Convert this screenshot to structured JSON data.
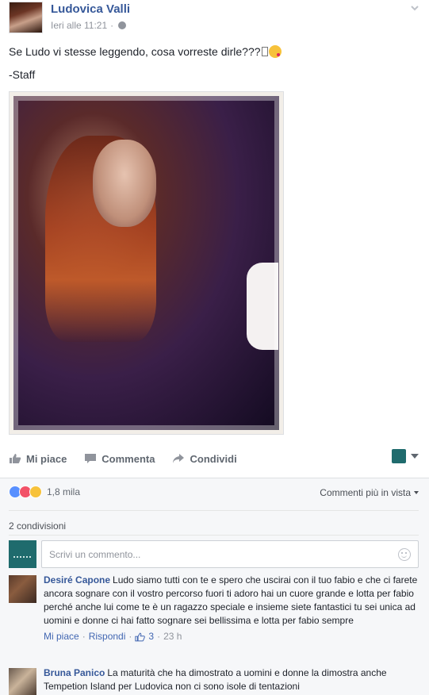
{
  "post": {
    "author": "Ludovica Valli",
    "time": "Ieri alle 11:21",
    "separator": "·",
    "text": "Se Ludo vi stesse leggendo, cosa vorreste dirle???",
    "signature": "-Staff"
  },
  "actions": {
    "like": "Mi piace",
    "comment": "Commenta",
    "share": "Condividi"
  },
  "reactions": {
    "count": "1,8 mila",
    "sort_label": "Commenti più in vista"
  },
  "shares": "2 condivisioni",
  "composer": {
    "placeholder": "Scrivi un commento..."
  },
  "comments": [
    {
      "name": "Desiré Capone",
      "text": "Ludo siamo tutti con te e spero che uscirai con il tuo fabio e che ci farete ancora sognare con il vostro percorso fuori ti adoro hai un cuore grande e lotta per fabio perché anche lui come te è un ragazzo speciale e insieme siete fantastici tu sei unica ad uomini e donne ci hai fatto sognare sei bellissima e lotta per fabio sempre",
      "like_label": "Mi piace",
      "reply_label": "Rispondi",
      "likes": "3",
      "time": "23 h"
    },
    {
      "name": "Bruna Panico",
      "text": "La maturità che ha dimostrato a uomini e donne la dimostra anche Tempetion Island per Ludovica non ci sono isole di tentazioni"
    }
  ],
  "colors": {
    "link": "#365899",
    "meta": "#90949c",
    "action": "#606770",
    "comment_bg": "#f6f7f9",
    "like_blue": "#5890ff",
    "love_red": "#f25268",
    "haha_yellow": "#f7c23b"
  },
  "icons": [
    "chevron-down-icon",
    "globe-icon",
    "like-icon",
    "comment-icon",
    "share-icon",
    "smile-icon",
    "like-reaction-icon",
    "love-reaction-icon",
    "haha-reaction-icon"
  ]
}
